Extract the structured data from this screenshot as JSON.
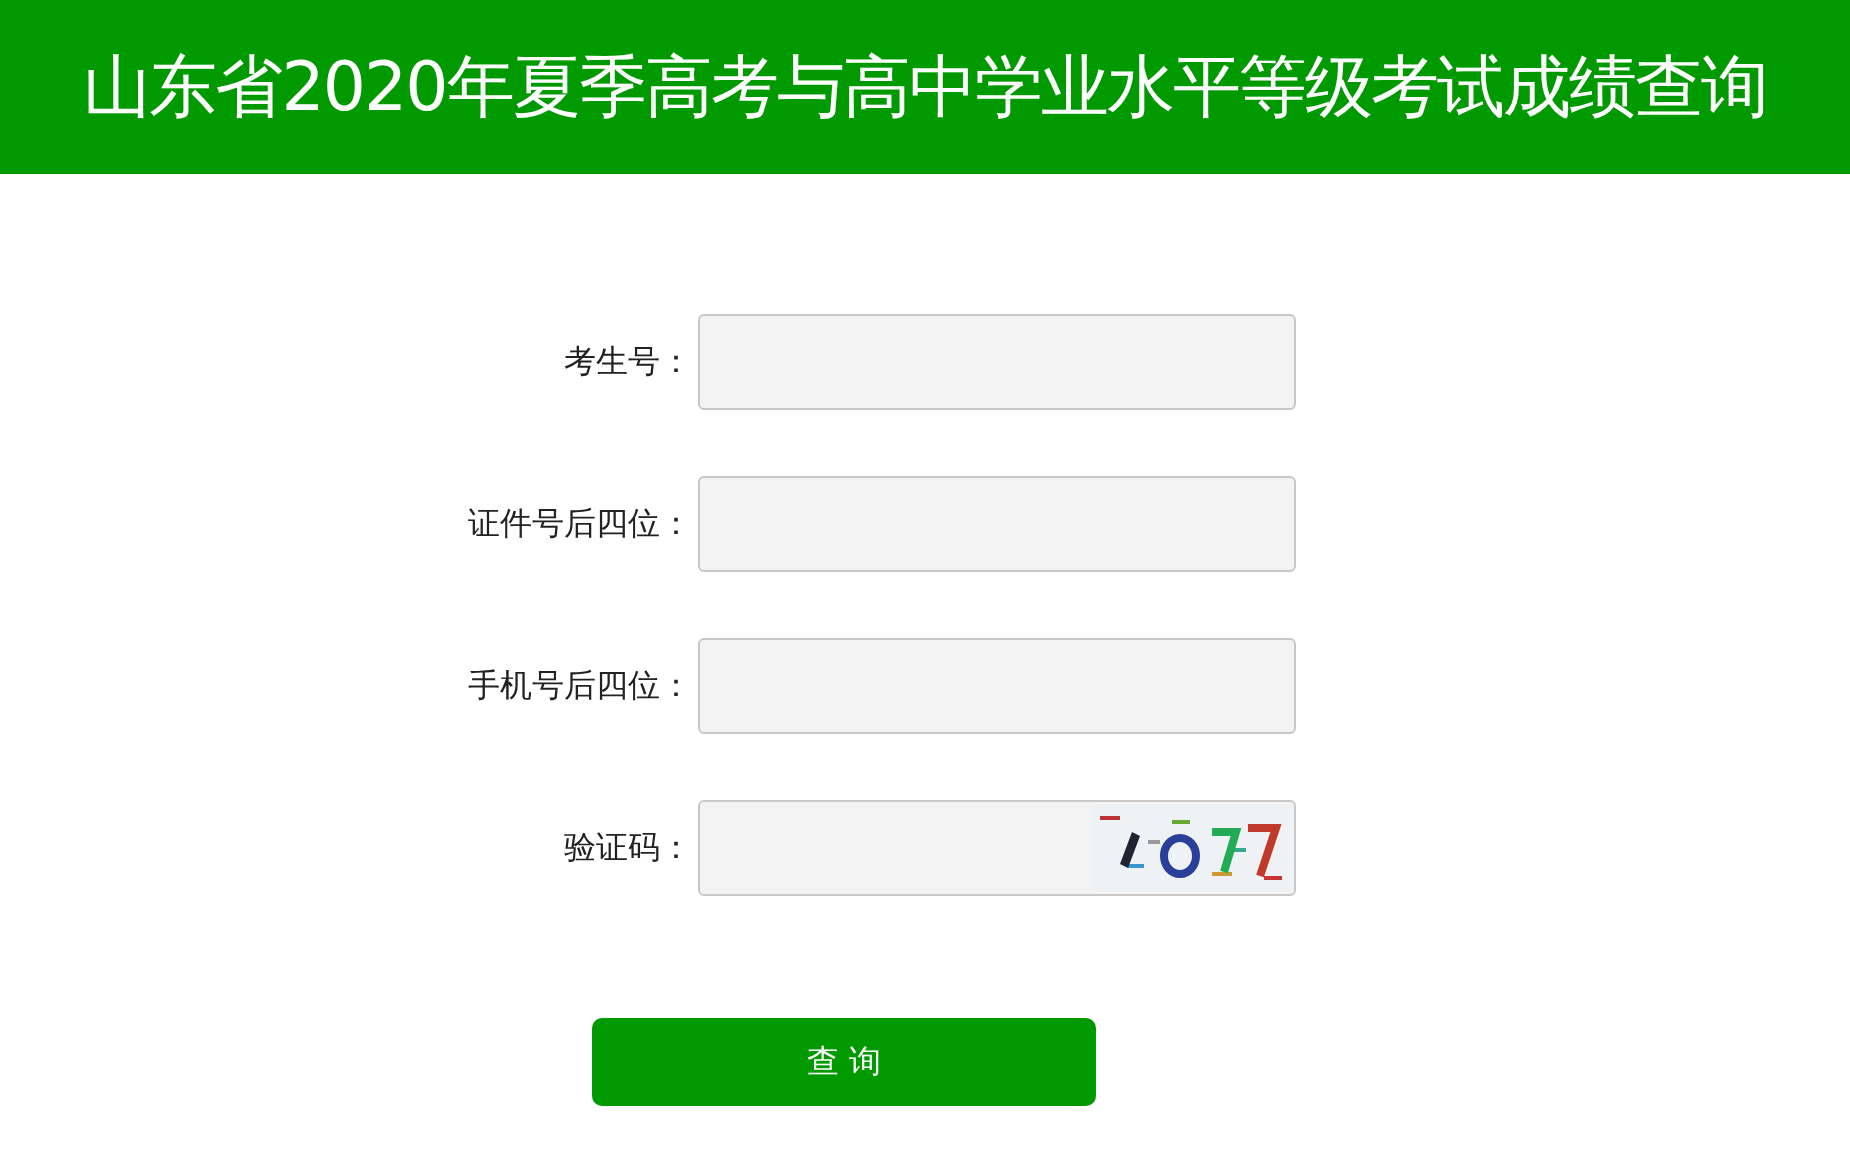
{
  "header": {
    "title": "山东省2020年夏季高考与高中学业水平等级考试成绩查询"
  },
  "fields": [
    {
      "label": "考生号：",
      "kind": "text"
    },
    {
      "label": "证件号后四位：",
      "kind": "text"
    },
    {
      "label": "手机号后四位：",
      "kind": "text"
    },
    {
      "label": "验证码：",
      "kind": "captcha"
    }
  ],
  "submit_button": "查 询"
}
